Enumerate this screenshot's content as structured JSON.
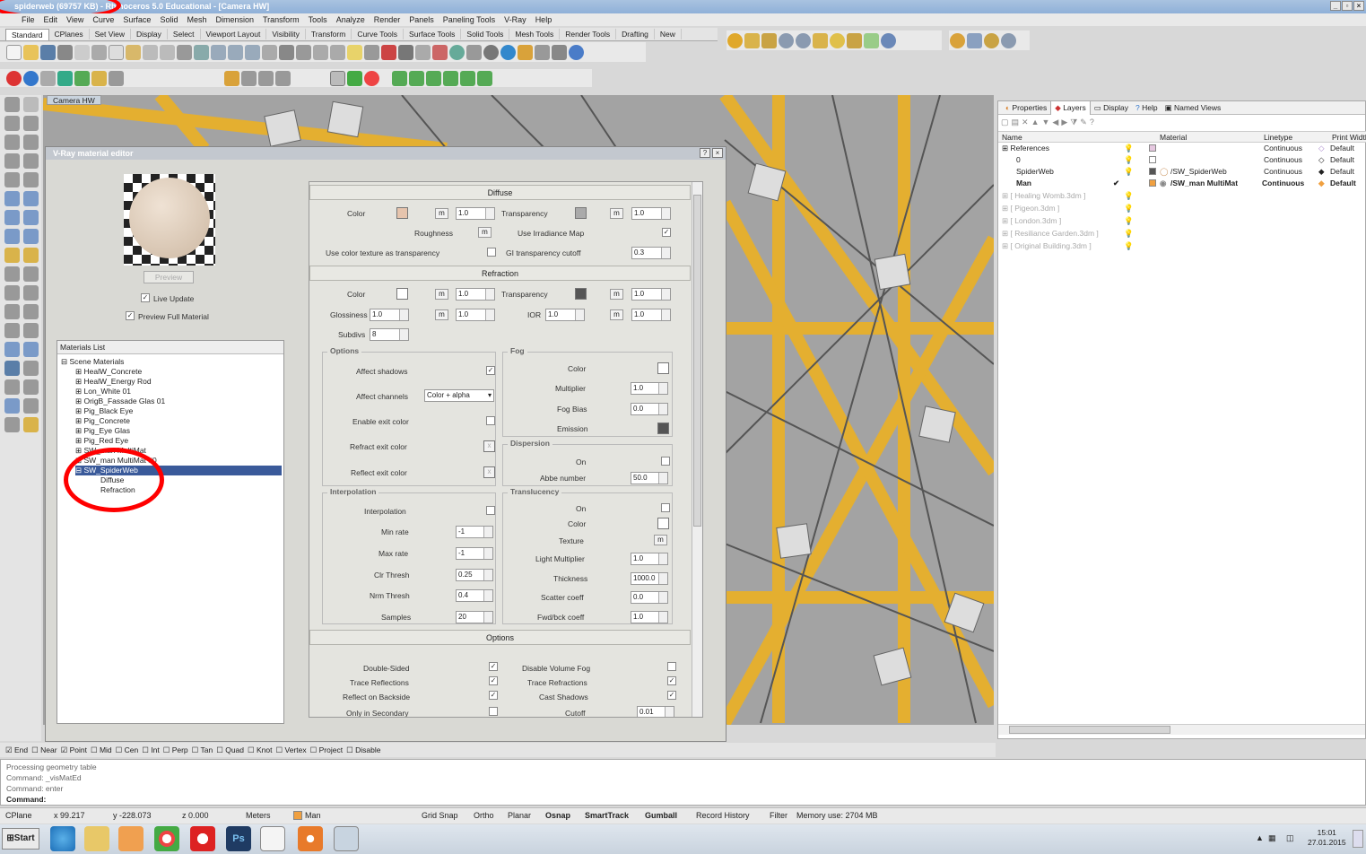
{
  "window": {
    "title": "spiderweb (69757 KB) - Rhinoceros 5.0 Educational - [Camera HW]"
  },
  "menu": [
    "File",
    "Edit",
    "View",
    "Curve",
    "Surface",
    "Solid",
    "Mesh",
    "Dimension",
    "Transform",
    "Tools",
    "Analyze",
    "Render",
    "Panels",
    "Paneling Tools",
    "V-Ray",
    "Help"
  ],
  "tabs": [
    "Standard",
    "CPlanes",
    "Set View",
    "Display",
    "Select",
    "Viewport Layout",
    "Visibility",
    "Transform",
    "Curve Tools",
    "Surface Tools",
    "Solid Tools",
    "Mesh Tools",
    "Render Tools",
    "Drafting",
    "New"
  ],
  "viewport": {
    "label": "Camera HW"
  },
  "vray": {
    "title": "V-Ray material editor",
    "preview_label": "Preview",
    "live_update": "Live Update",
    "preview_full": "Preview Full Material",
    "materials_list_title": "Materials List",
    "scene_materials": "Scene Materials",
    "materials": [
      "HealW_Concrete",
      "HealW_Energy Rod",
      "Lon_White 01",
      "OrigB_Fassade Glas 01",
      "Pig_Black Eye",
      "Pig_Concrete",
      "Pig_Eye Glas",
      "Pig_Red Eye",
      "SW_man MultiMat",
      "SW_man MultiMat #0"
    ],
    "selected": "SW_SpiderWeb",
    "subitems": [
      "Diffuse",
      "Refraction"
    ],
    "diffuse": {
      "title": "Diffuse",
      "color": "Color",
      "color_val": "1.0",
      "transparency": "Transparency",
      "transp_val": "1.0",
      "roughness": "Roughness",
      "irradiance": "Use Irradiance Map",
      "use_color_tex": "Use color texture as transparency",
      "gi_cutoff": "GI transparency cutoff",
      "gi_val": "0.3"
    },
    "refraction": {
      "title": "Refraction",
      "color": "Color",
      "color_val": "1.0",
      "transparency": "Transparency",
      "transp_val": "1.0",
      "glossiness": "Glossiness",
      "gloss_val": "1.0",
      "gloss_m": "1.0",
      "ior": "IOR",
      "ior_val": "1.0",
      "ior_m": "1.0",
      "subdivs": "Subdivs",
      "subdivs_val": "8"
    },
    "options": {
      "title": "Options",
      "affect_shadows": "Affect shadows",
      "affect_channels": "Affect channels",
      "channels_val": "Color + alpha",
      "enable_exit": "Enable exit color",
      "refract_exit": "Refract exit color",
      "reflect_exit": "Reflect exit color"
    },
    "fog": {
      "title": "Fog",
      "color": "Color",
      "multiplier": "Multiplier",
      "mult_val": "1.0",
      "bias": "Fog Bias",
      "bias_val": "0.0",
      "emission": "Emission"
    },
    "dispersion": {
      "title": "Dispersion",
      "on": "On",
      "abbe": "Abbe number",
      "abbe_val": "50.0"
    },
    "interpolation": {
      "title": "Interpolation",
      "interp": "Interpolation",
      "min_rate": "Min rate",
      "min_val": "-1",
      "max_rate": "Max rate",
      "max_val": "-1",
      "clr": "Clr Thresh",
      "clr_val": "0.25",
      "nrm": "Nrm Thresh",
      "nrm_val": "0.4",
      "samples": "Samples",
      "samples_val": "20"
    },
    "translucency": {
      "title": "Translucency",
      "on": "On",
      "color": "Color",
      "texture": "Texture",
      "light_mult": "Light Multiplier",
      "light_val": "1.0",
      "thickness": "Thickness",
      "thick_val": "1000.0",
      "scatter": "Scatter coeff",
      "scatter_val": "0.0",
      "fwd": "Fwd/bck coeff",
      "fwd_val": "1.0"
    },
    "options2": {
      "title": "Options",
      "double_sided": "Double-Sided",
      "trace_refl": "Trace Reflections",
      "reflect_back": "Reflect on Backside",
      "only_secondary": "Only in Secondary",
      "disable_fog": "Disable Volume Fog",
      "trace_refr": "Trace Refractions",
      "cast_shadows": "Cast Shadows",
      "cutoff": "Cutoff",
      "cutoff_val": "0.01"
    }
  },
  "panel": {
    "tabs": [
      "Properties",
      "Layers",
      "Display",
      "Help",
      "Named Views"
    ],
    "columns": [
      "Name",
      "Material",
      "Linetype",
      "Print Width"
    ],
    "layers": [
      {
        "name": "References",
        "material": "",
        "linetype": "Continuous",
        "print": "Default"
      },
      {
        "name": "0",
        "material": "",
        "linetype": "Continuous",
        "print": "Default"
      },
      {
        "name": "SpiderWeb",
        "material": "/SW_SpiderWeb",
        "linetype": "Continuous",
        "print": "Default"
      },
      {
        "name": "Man",
        "material": "/SW_man MultiMat",
        "linetype": "Continuous",
        "print": "Default"
      },
      {
        "name": "[ Healing Womb.3dm ]",
        "material": "",
        "linetype": "",
        "print": ""
      },
      {
        "name": "[ Pigeon.3dm ]",
        "material": "",
        "linetype": "",
        "print": ""
      },
      {
        "name": "[ London.3dm ]",
        "material": "",
        "linetype": "",
        "print": ""
      },
      {
        "name": "[ Resiliance Garden.3dm ]",
        "material": "",
        "linetype": "",
        "print": ""
      },
      {
        "name": "[ Original Building.3dm ]",
        "material": "",
        "linetype": "",
        "print": ""
      }
    ]
  },
  "osnap": [
    "End",
    "Near",
    "Point",
    "Mid",
    "Cen",
    "Int",
    "Perp",
    "Tan",
    "Quad",
    "Knot",
    "Vertex",
    "Project",
    "Disable"
  ],
  "command": {
    "lines": [
      "Processing geometry table",
      "Command: _visMatEd",
      "Command: enter"
    ],
    "prompt": "Command:"
  },
  "status": {
    "cplane": "CPlane",
    "x": "x 99.217",
    "y": "y -228.073",
    "z": "z 0.000",
    "units": "Meters",
    "layer": "Man",
    "items": [
      "Grid Snap",
      "Ortho",
      "Planar",
      "Osnap",
      "SmartTrack",
      "Gumball",
      "Record History",
      "Filter"
    ],
    "memory": "Memory use: 2704 MB"
  },
  "taskbar": {
    "start": "Start",
    "time": "15:01",
    "date": "27.01.2015"
  },
  "colors": {
    "accent": "#f0b21c",
    "selection": "#3a5a9a",
    "diffuse_swatch": "#e6c4ad"
  }
}
